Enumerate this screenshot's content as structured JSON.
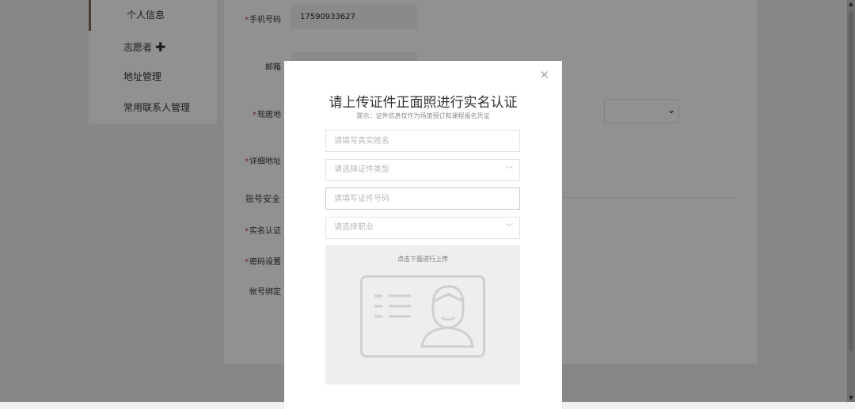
{
  "sidebar": {
    "items": [
      {
        "label": "个人信息"
      },
      {
        "label": "志愿者"
      },
      {
        "label": "地址管理"
      },
      {
        "label": "常用联系人管理"
      }
    ]
  },
  "form": {
    "phone_label": "手机号码",
    "phone_value": "17590933627",
    "email_label": "邮箱",
    "region_label": "现居地",
    "address_label": "详细地址",
    "account_security_title": "账号安全",
    "realname_label": "实名认证",
    "password_label": "密码设置",
    "binding_label": "帐号绑定"
  },
  "modal": {
    "close_symbol": "×",
    "title": "请上传证件正面照进行实名认证",
    "hint": "提示：证件信息仅作为场馆预订和课程报名凭证",
    "name_placeholder": "请填写真实姓名",
    "id_type_placeholder": "请选择证件类型",
    "id_number_placeholder": "请填写证件号码",
    "occupation_placeholder": "请选择职业",
    "upload_hint": "点击下面进行上传"
  },
  "icons": {
    "plus": "plus-icon",
    "chevron": "chevron-down-icon",
    "idcard": "id-card-icon"
  },
  "colors": {
    "accent_border": "#7b6a55",
    "required": "#c0392b",
    "overlay": "rgba(0,0,0,0.43)"
  }
}
